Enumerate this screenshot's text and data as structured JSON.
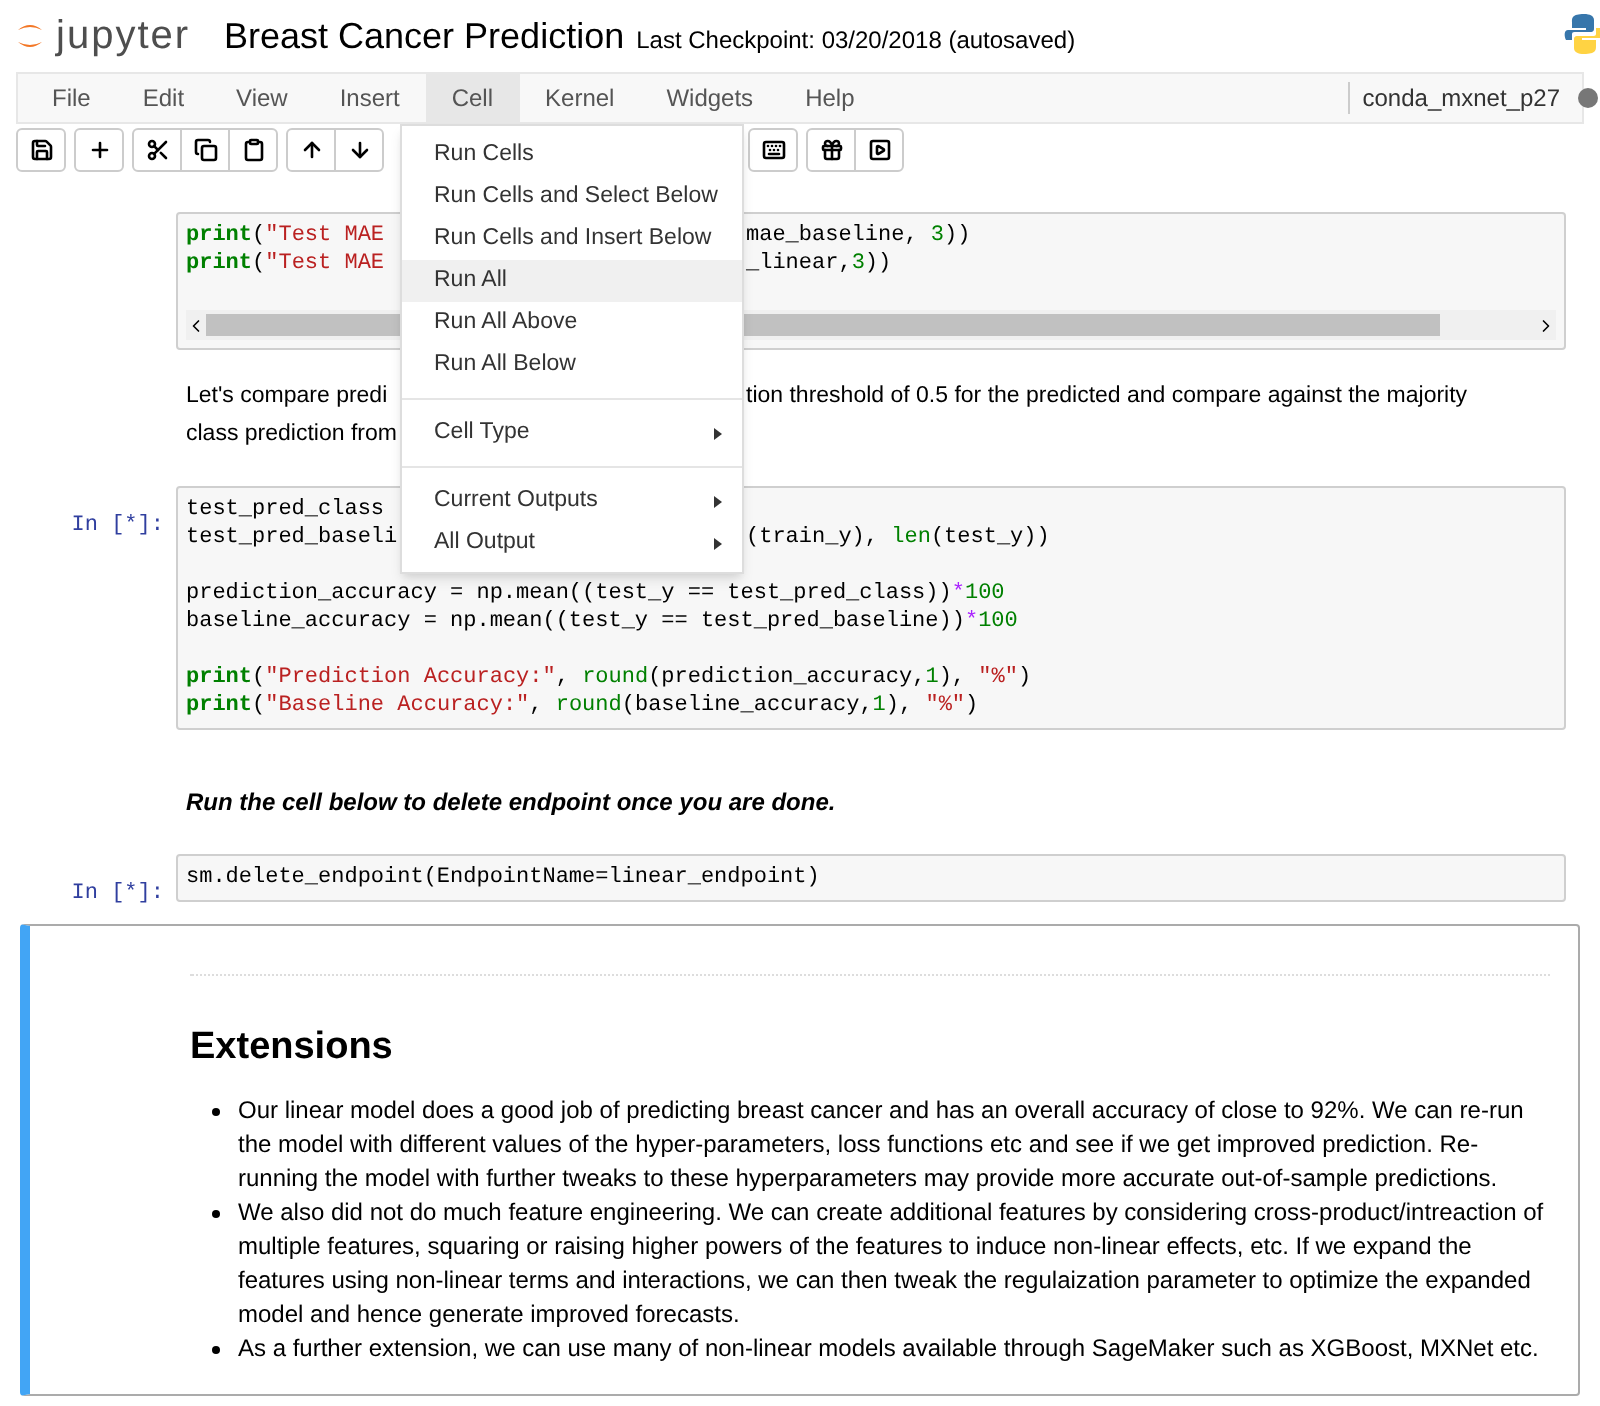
{
  "header": {
    "logo_text": "jupyter",
    "title": "Breast Cancer Prediction",
    "checkpoint": "Last Checkpoint: 03/20/2018 (autosaved)"
  },
  "menus": [
    {
      "label": "File",
      "selected": false
    },
    {
      "label": "Edit",
      "selected": false
    },
    {
      "label": "View",
      "selected": false
    },
    {
      "label": "Insert",
      "selected": false
    },
    {
      "label": "Cell",
      "selected": true
    },
    {
      "label": "Kernel",
      "selected": false
    },
    {
      "label": "Widgets",
      "selected": false
    },
    {
      "label": "Help",
      "selected": false
    }
  ],
  "kernel": {
    "name": "conda_mxnet_p27"
  },
  "dropdown": [
    {
      "kind": "item",
      "label": "Run Cells",
      "highlighted": false,
      "submenu": false
    },
    {
      "kind": "item",
      "label": "Run Cells and Select Below",
      "highlighted": false,
      "submenu": false
    },
    {
      "kind": "item",
      "label": "Run Cells and Insert Below",
      "highlighted": false,
      "submenu": false
    },
    {
      "kind": "item",
      "label": "Run All",
      "highlighted": true,
      "submenu": false
    },
    {
      "kind": "item",
      "label": "Run All Above",
      "highlighted": false,
      "submenu": false
    },
    {
      "kind": "item",
      "label": "Run All Below",
      "highlighted": false,
      "submenu": false
    },
    {
      "kind": "divider"
    },
    {
      "kind": "item",
      "label": "Cell Type",
      "highlighted": false,
      "submenu": true
    },
    {
      "kind": "divider"
    },
    {
      "kind": "item",
      "label": "Current Outputs",
      "highlighted": false,
      "submenu": true
    },
    {
      "kind": "item",
      "label": "All Output",
      "highlighted": false,
      "submenu": true
    }
  ],
  "cells": [
    {
      "kind": "code",
      "scrollbar": true,
      "blocks": [
        [
          {
            "left": [
              {
                "text": "print",
                "kind": "keyword"
              },
              {
                "text": "(",
                "kind": "plain"
              },
              {
                "text": "\"Test MAE",
                "kind": "string"
              }
            ],
            "right": [
              {
                "text": "mae_baseline, ",
                "kind": "plain"
              },
              {
                "text": "3",
                "kind": "number"
              },
              {
                "text": "))",
                "kind": "plain"
              }
            ]
          },
          {
            "left": [
              {
                "text": "print",
                "kind": "keyword"
              },
              {
                "text": "(",
                "kind": "plain"
              },
              {
                "text": "\"Test MAE",
                "kind": "string"
              }
            ],
            "right": [
              {
                "text": "_linear,",
                "kind": "plain"
              },
              {
                "text": "3",
                "kind": "number"
              },
              {
                "text": "))",
                "kind": "plain"
              }
            ]
          }
        ]
      ]
    },
    {
      "kind": "text",
      "lines": [
        {
          "left": "Let's compare predi",
          "right": "tion threshold of 0.5 for the predicted and compare against the majority"
        },
        {
          "left": "class prediction from"
        }
      ]
    },
    {
      "kind": "code",
      "prompt": "In [*]:",
      "blocks": [
        [
          {
            "left": [
              {
                "text": "test_pred_class",
                "kind": "plain"
              }
            ]
          },
          {
            "left": [
              {
                "text": "test_pred_baseli",
                "kind": "plain"
              }
            ],
            "right": [
              {
                "text": "(train_y), ",
                "kind": "plain"
              },
              {
                "text": "len",
                "kind": "builtin"
              },
              {
                "text": "(test_y))",
                "kind": "plain"
              }
            ]
          }
        ],
        [
          {
            "left": [
              {
                "text": "prediction_accuracy = np.mean((test_y == test_pred_class))",
                "kind": "plain"
              },
              {
                "text": "*",
                "kind": "operator"
              },
              {
                "text": "100",
                "kind": "number"
              }
            ]
          },
          {
            "left": [
              {
                "text": "baseline_accuracy = np.mean((test_y == test_pred_baseline))",
                "kind": "plain"
              },
              {
                "text": "*",
                "kind": "operator"
              },
              {
                "text": "100",
                "kind": "number"
              }
            ]
          }
        ],
        [
          {
            "left": [
              {
                "text": "print",
                "kind": "keyword"
              },
              {
                "text": "(",
                "kind": "plain"
              },
              {
                "text": "\"Prediction Accuracy:\"",
                "kind": "string"
              },
              {
                "text": ", ",
                "kind": "plain"
              },
              {
                "text": "round",
                "kind": "builtin"
              },
              {
                "text": "(prediction_accuracy,",
                "kind": "plain"
              },
              {
                "text": "1",
                "kind": "number"
              },
              {
                "text": "), ",
                "kind": "plain"
              },
              {
                "text": "\"%\"",
                "kind": "string"
              },
              {
                "text": ")",
                "kind": "plain"
              }
            ]
          },
          {
            "left": [
              {
                "text": "print",
                "kind": "keyword"
              },
              {
                "text": "(",
                "kind": "plain"
              },
              {
                "text": "\"Baseline Accuracy:\"",
                "kind": "string"
              },
              {
                "text": ", ",
                "kind": "plain"
              },
              {
                "text": "round",
                "kind": "builtin"
              },
              {
                "text": "(baseline_accuracy,",
                "kind": "plain"
              },
              {
                "text": "1",
                "kind": "number"
              },
              {
                "text": "), ",
                "kind": "plain"
              },
              {
                "text": "\"%\"",
                "kind": "string"
              },
              {
                "text": ")",
                "kind": "plain"
              }
            ]
          }
        ]
      ]
    },
    {
      "kind": "note",
      "text": "Run the cell below to delete endpoint once you are done."
    },
    {
      "kind": "code",
      "prompt": "In [*]:",
      "blocks": [
        [
          {
            "left": [
              {
                "text": "sm.delete_endpoint(EndpointName=linear_endpoint)",
                "kind": "plain"
              }
            ]
          }
        ]
      ]
    },
    {
      "kind": "markdown",
      "selected": true,
      "heading": "Extensions",
      "bullets": [
        "Our linear model does a good job of predicting breast cancer and has an overall accuracy of close to 92%. We can re-run the model with different values of the hyper-parameters, loss functions etc and see if we get improved prediction. Re-running the model with further tweaks to these hyperparameters may provide more accurate out-of-sample predictions.",
        "We also did not do much feature engineering. We can create additional features by considering cross-product/intreaction of multiple features, squaring or raising higher powers of the features to induce non-linear effects, etc. If we expand the features using non-linear terms and interactions, we can then tweak the regulaization parameter to optimize the expanded model and hence generate improved forecasts.",
        "As a further extension, we can use many of non-linear models available through SageMaker such as XGBoost, MXNet etc."
      ]
    }
  ]
}
